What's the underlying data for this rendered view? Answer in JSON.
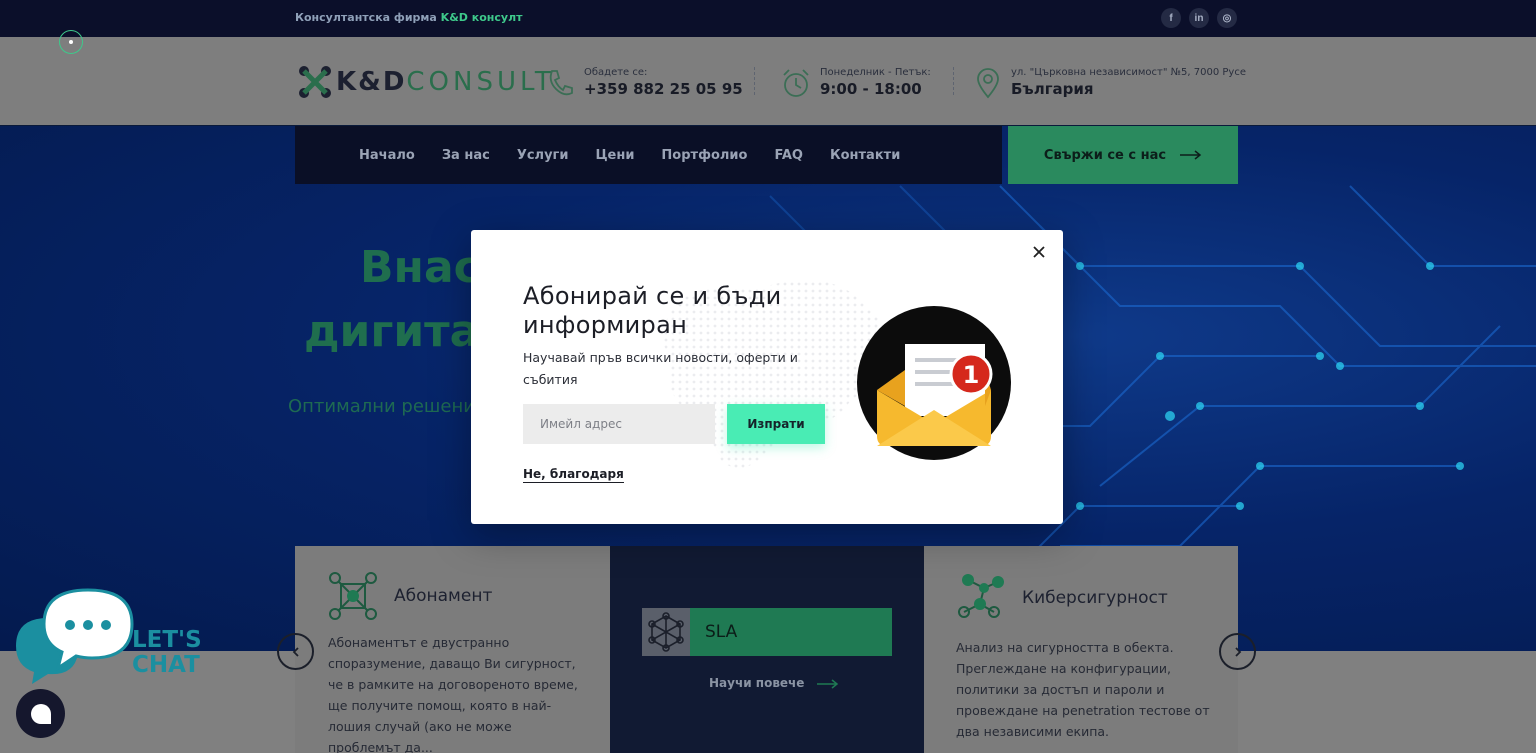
{
  "topbar": {
    "prefix": "Консултантска фирма",
    "brand": "K&D консулт",
    "social": [
      {
        "icon": "facebook-icon",
        "glyph": "f"
      },
      {
        "icon": "linkedin-icon",
        "glyph": "in"
      },
      {
        "icon": "instagram-icon",
        "glyph": "◎"
      }
    ]
  },
  "header": {
    "logo_bold": "K&D",
    "logo_thin": "CONSULT",
    "phone": {
      "label": "Обадете се:",
      "value": "+359 882 25 05 95"
    },
    "hours": {
      "label": "Понеделник - Петък:",
      "value": "9:00 - 18:00"
    },
    "address": {
      "label": "ул. \"Църковна независимост\" №5, 7000 Русе",
      "value": "България"
    }
  },
  "nav": {
    "items": [
      "Начало",
      "За нас",
      "Услуги",
      "Цени",
      "Портфолио",
      "FAQ",
      "Контакти"
    ],
    "cta": "Свържи се с нас"
  },
  "hero": {
    "title_line1": "Внася",
    "title_line2": "дигитал",
    "subtitle": "Оптимални решени"
  },
  "cards": {
    "subscription": {
      "title": "Абонамент",
      "text": "Абонаментът е двустранно споразумение, даващо Ви сигурност, че в рамките на договореното време, ще получите помощ, която в най-лошия случай (ако не може проблемът да..."
    },
    "sla": {
      "title": "SLA",
      "learn_more": "Научи повече"
    },
    "security": {
      "title": "Киберсигурност",
      "text": "Анализ на сигурността в обекта. Преглеждане на конфигурации, политики за достъп и пароли и провеждане на penetration тестове от два независими екипа."
    }
  },
  "chat": {
    "line1": "LET'S",
    "line2": "CHAT"
  },
  "modal": {
    "title": "Абонирай се и бъди информиран",
    "description": "Научавай пръв всички новости, оферти и събития",
    "email_placeholder": "Имейл адрес",
    "email_value": "",
    "submit": "Изпрати",
    "decline": "Не, благодаря",
    "badge_count": "1"
  },
  "colors": {
    "accent": "#49ecb4",
    "brand_green": "#3ec98b",
    "dark_navy": "#0b0f2a"
  }
}
